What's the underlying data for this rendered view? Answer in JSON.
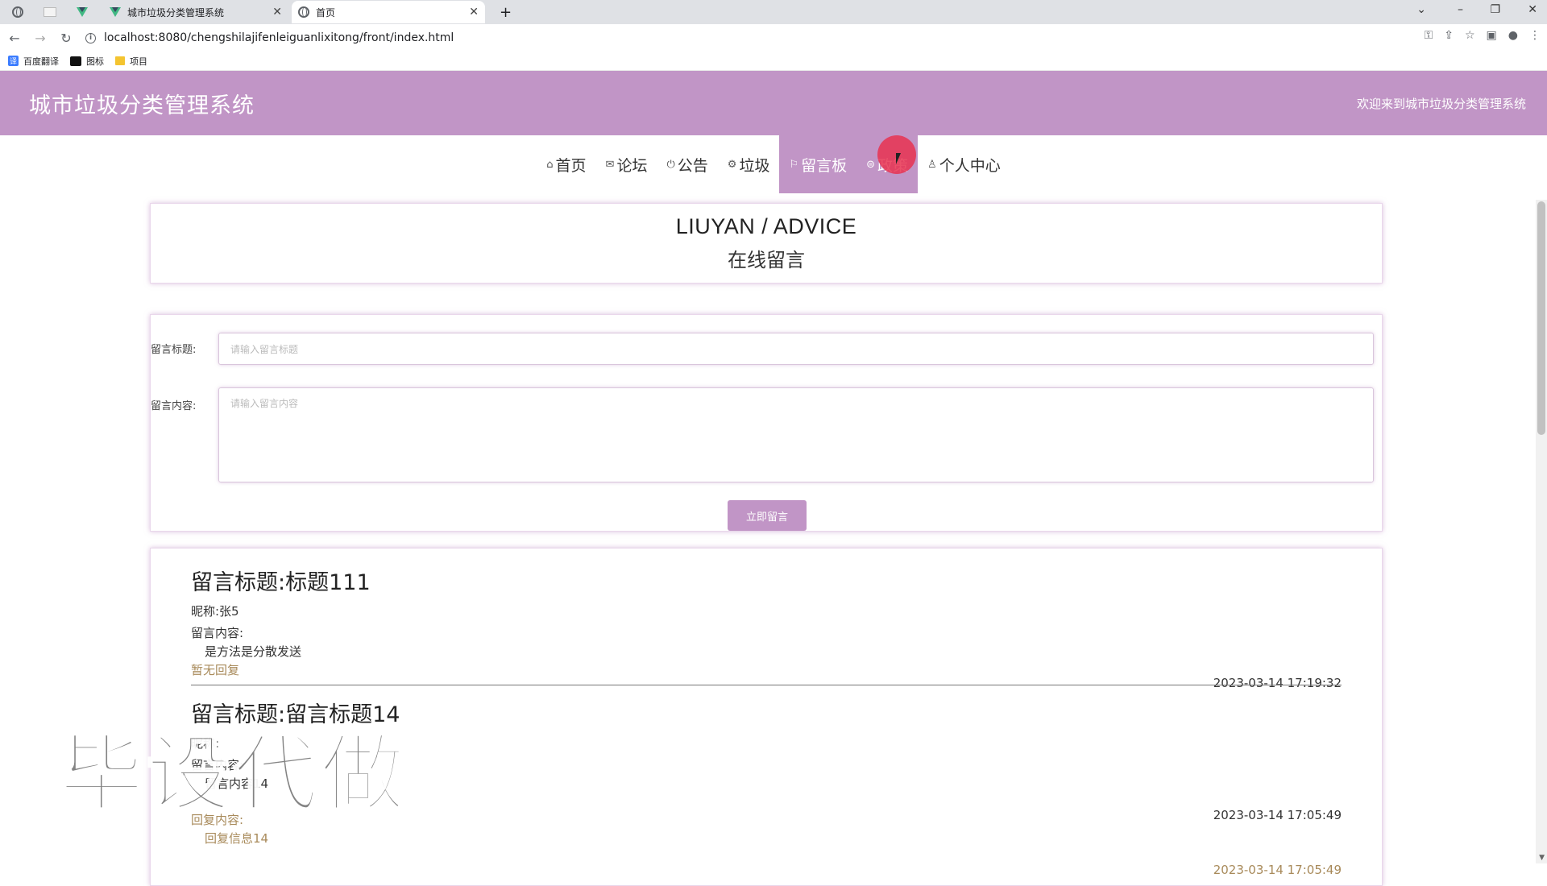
{
  "browser": {
    "tabs": [
      {
        "title": "城市垃圾分类管理系统",
        "icon": "vue-icon"
      },
      {
        "title": "首页",
        "icon": "globe-icon"
      }
    ],
    "new_tab": "+",
    "url": "localhost:8080/chengshilajifenleiguanlixitong/front/index.html",
    "bookmarks": [
      {
        "label": "百度翻译",
        "icon": "translate-icon"
      },
      {
        "label": "图标",
        "icon": "image-icon"
      },
      {
        "label": "项目",
        "icon": "folder-icon"
      }
    ]
  },
  "header": {
    "title": "城市垃圾分类管理系统",
    "welcome": "欢迎来到城市垃圾分类管理系统"
  },
  "nav": {
    "items": [
      {
        "label": "首页",
        "icon": "home-icon",
        "glyph": "⌂"
      },
      {
        "label": "论坛",
        "icon": "mail-icon",
        "glyph": "✉"
      },
      {
        "label": "公告",
        "icon": "power-icon",
        "glyph": "⏻"
      },
      {
        "label": "垃圾",
        "icon": "gear-icon",
        "glyph": "⚙"
      },
      {
        "label": "留言板",
        "icon": "flag-icon",
        "glyph": "⚐"
      },
      {
        "label": "政策",
        "icon": "policy-icon",
        "glyph": "⊜"
      },
      {
        "label": "个人中心",
        "icon": "user-icon",
        "glyph": "♙"
      }
    ]
  },
  "page": {
    "title_en": "LIUYAN / ADVICE",
    "title_cn": "在线留言"
  },
  "form": {
    "title_label": "留言标题:",
    "title_placeholder": "请输入留言标题",
    "content_label": "留言内容:",
    "content_placeholder": "请输入留言内容",
    "submit_label": "立即留言"
  },
  "messages": [
    {
      "title": "留言标题:标题111",
      "nickname": "昵称:张5",
      "content_label": "留言内容:",
      "content": "是方法是分散发送",
      "reply": "暂无回复",
      "time": "2023-03-14 17:19:32"
    },
    {
      "title": "留言标题:留言标题14",
      "nickname": "昵称:",
      "content_label": "留言内容:",
      "content": "留言内容14",
      "time": "2023-03-14 17:05:49",
      "reply_label": "回复内容:",
      "reply_content": "回复信息14",
      "reply_time": "2023-03-14 17:05:49"
    }
  ],
  "watermark": "毕设代做",
  "colors": {
    "accent": "#c195c6",
    "reply": "#a88a5a"
  }
}
